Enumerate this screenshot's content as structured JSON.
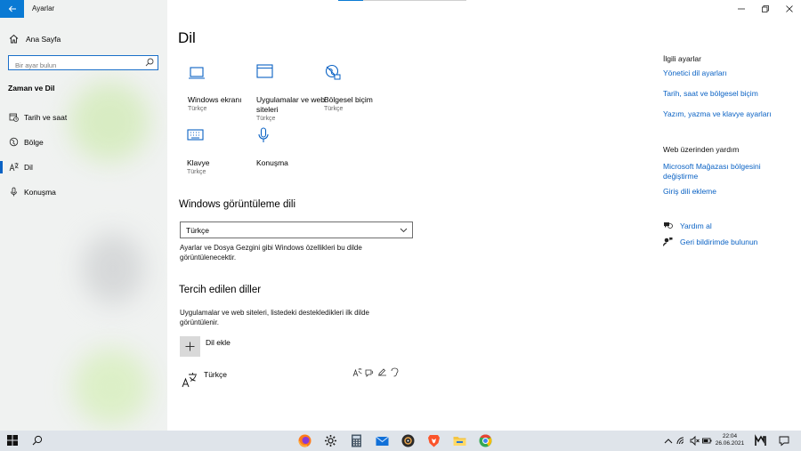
{
  "window": {
    "app_title": "Ayarlar"
  },
  "sidebar": {
    "home_label": "Ana Sayfa",
    "search_placeholder": "Bir ayar bulun",
    "group_title": "Zaman ve Dil",
    "items": [
      {
        "label": "Tarih ve saat",
        "icon": "calendar-clock-icon"
      },
      {
        "label": "Bölge",
        "icon": "globe-icon"
      },
      {
        "label": "Dil",
        "icon": "language-icon",
        "active": true
      },
      {
        "label": "Konuşma",
        "icon": "microphone-icon"
      }
    ]
  },
  "main": {
    "title": "Dil",
    "tiles": [
      {
        "name": "Windows ekranı",
        "sub": "Türkçe",
        "icon": "laptop-icon"
      },
      {
        "name": "Uygulamalar ve web siteleri",
        "sub": "Türkçe",
        "icon": "app-window-icon"
      },
      {
        "name": "Bölgesel biçim",
        "sub": "Türkçe",
        "icon": "regional-format-icon"
      },
      {
        "name": "Klavye",
        "sub": "Türkçe",
        "icon": "keyboard-icon"
      },
      {
        "name": "Konuşma",
        "sub": "",
        "icon": "microphone-icon"
      }
    ],
    "display_language": {
      "heading": "Windows görüntüleme dili",
      "selected": "Türkçe",
      "description": "Ayarlar ve Dosya Gezgini gibi Windows özellikleri bu dilde görüntülenecektir."
    },
    "preferred": {
      "heading": "Tercih edilen diller",
      "description": "Uygulamalar ve web siteleri, listedeki destekledikleri ilk dilde görüntülenir.",
      "add_label": "Dil ekle",
      "languages": [
        {
          "name": "Türkçe"
        }
      ]
    }
  },
  "right": {
    "related_heading": "İlgili ayarlar",
    "related_links": [
      "Yönetici dil ayarları",
      "Tarih, saat ve bölgesel biçim",
      "Yazım, yazma ve klavye ayarları"
    ],
    "web_help_heading": "Web üzerinden yardım",
    "web_help_links": [
      "Microsoft Mağazası bölgesini değiştirme",
      "Giriş dili ekleme"
    ],
    "help_label": "Yardım al",
    "feedback_label": "Geri bildirimde bulunun"
  },
  "taskbar": {
    "time": "22:04",
    "date": "26.06.2021"
  },
  "colors": {
    "accent": "#0a7ad4",
    "link": "#0a62c4",
    "sidebar_bg": "#f0f2f1",
    "taskbar_bg": "#dfe4ea"
  }
}
